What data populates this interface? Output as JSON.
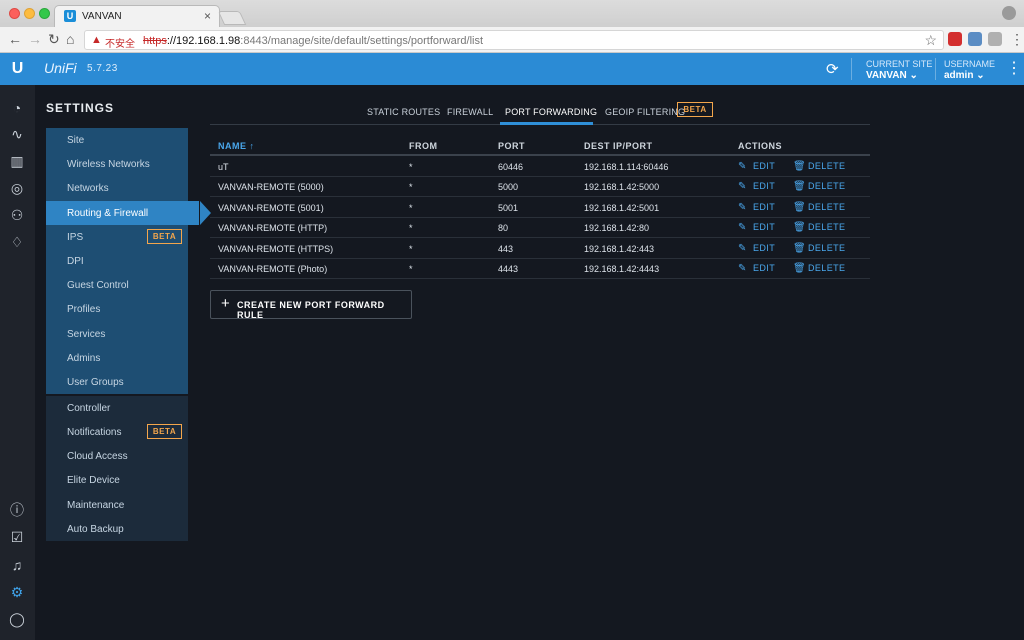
{
  "browser": {
    "tab_title": "VANVAN",
    "tab_favicon": "U",
    "close_glyph": "×",
    "insecure_label": "不安全",
    "url_scheme": "https",
    "url_host": "://192.168.1.98",
    "url_path": ":8443/manage/site/default/settings/portforward/list"
  },
  "header": {
    "logo": "U",
    "brand": "UniFi",
    "version": "5.7.23",
    "current_site_label": "CURRENT SITE",
    "current_site_value": "VANVAN",
    "username_label": "USERNAME",
    "username_value": "admin"
  },
  "settings": {
    "title": "SETTINGS",
    "group1": [
      {
        "label": "Site"
      },
      {
        "label": "Wireless Networks"
      },
      {
        "label": "Networks"
      },
      {
        "label": "Routing & Firewall",
        "active": true
      },
      {
        "label": "IPS",
        "badge": "BETA"
      },
      {
        "label": "DPI"
      },
      {
        "label": "Guest Control"
      },
      {
        "label": "Profiles"
      },
      {
        "label": "Services"
      },
      {
        "label": "Admins"
      },
      {
        "label": "User Groups"
      }
    ],
    "group2": [
      {
        "label": "Controller"
      },
      {
        "label": "Notifications",
        "badge": "BETA"
      },
      {
        "label": "Cloud Access"
      },
      {
        "label": "Elite Device"
      },
      {
        "label": "Maintenance"
      },
      {
        "label": "Auto Backup"
      }
    ]
  },
  "tabs": [
    {
      "label": "STATIC ROUTES"
    },
    {
      "label": "FIREWALL"
    },
    {
      "label": "PORT FORWARDING",
      "active": true
    },
    {
      "label": "GEOIP FILTERING",
      "badge": "BETA"
    }
  ],
  "table": {
    "headers": {
      "name": "NAME ↑",
      "from": "FROM",
      "port": "PORT",
      "dest": "DEST IP/PORT",
      "actions": "ACTIONS"
    },
    "edit_label": "EDIT",
    "delete_label": "DELETE",
    "rows": [
      {
        "name": "uT",
        "from": "*",
        "port": "60446",
        "dest": "192.168.1.114:60446"
      },
      {
        "name": "VANVAN-REMOTE (5000)",
        "from": "*",
        "port": "5000",
        "dest": "192.168.1.42:5000"
      },
      {
        "name": "VANVAN-REMOTE (5001)",
        "from": "*",
        "port": "5001",
        "dest": "192.168.1.42:5001"
      },
      {
        "name": "VANVAN-REMOTE (HTTP)",
        "from": "*",
        "port": "80",
        "dest": "192.168.1.42:80"
      },
      {
        "name": "VANVAN-REMOTE (HTTPS)",
        "from": "*",
        "port": "443",
        "dest": "192.168.1.42:443"
      },
      {
        "name": "VANVAN-REMOTE (Photo)",
        "from": "*",
        "port": "4443",
        "dest": "192.168.1.42:4443"
      }
    ]
  },
  "create_button": {
    "plus": "+",
    "label": "CREATE NEW PORT FORWARD RULE"
  },
  "colors": {
    "header": "#2b8bd5",
    "accent": "#4aa7ec",
    "beta": "#f3a64c",
    "background": "#141820"
  }
}
